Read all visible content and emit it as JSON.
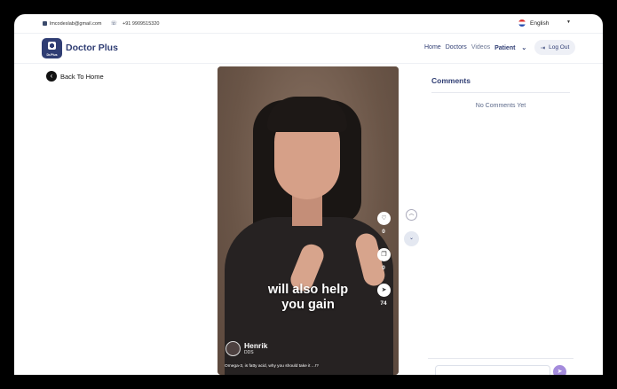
{
  "topbar": {
    "email": "lmcodeslab@gmail.com",
    "phone": "+91 9909515320",
    "language": "English"
  },
  "nav": {
    "logo_text": "Dr.Plus",
    "brand": "Doctor Plus",
    "links": [
      "Home",
      "Doctors",
      "Videos",
      "Patient"
    ],
    "logout": "Log Out"
  },
  "back_label": "Back To Home",
  "video": {
    "caption_line1": "will also help",
    "caption_line2": "you gain",
    "author_name": "Henrik",
    "author_role": "DDS",
    "description": "Omega-3, is fatty acid, why you should take it ...!?",
    "likes": "0",
    "comments": "0",
    "shares": "74"
  },
  "comments": {
    "title": "Comments",
    "empty": "No Comments Yet"
  },
  "colors": {
    "brand": "#2f3d73",
    "send": "#a48bdc"
  }
}
